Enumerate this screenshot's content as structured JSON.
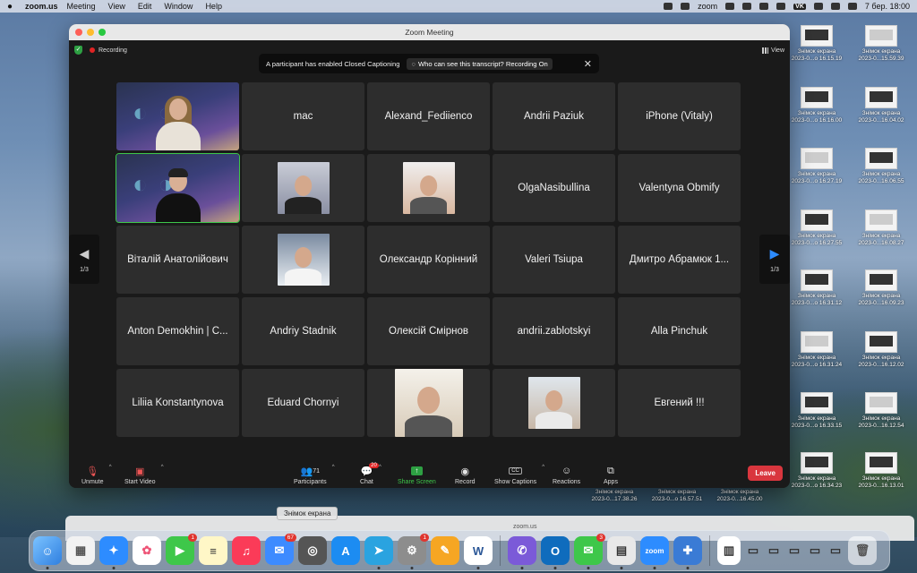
{
  "menubar": {
    "app_name": "zoom.us",
    "items": [
      "Meeting",
      "View",
      "Edit",
      "Window",
      "Help"
    ],
    "zoom_label": "zoom",
    "vk_label": "VK",
    "date_time": "7 бер.  18:00"
  },
  "window": {
    "title": "Zoom Meeting",
    "recording_label": "Recording",
    "view_label": "View"
  },
  "toast": {
    "message": "A participant has enabled Closed Captioning",
    "link": "Who can see this transcript? Recording On",
    "close": "✕"
  },
  "participants": [
    {
      "name": "",
      "type": "camera",
      "gender": "f"
    },
    {
      "name": "mac",
      "type": "name"
    },
    {
      "name": "Alexand_Fediienco",
      "type": "name"
    },
    {
      "name": "Andrii Paziuk",
      "type": "name"
    },
    {
      "name": "iPhone (Vitaly)",
      "type": "name"
    },
    {
      "name": "",
      "type": "camera",
      "gender": "m",
      "active": true
    },
    {
      "name": "",
      "type": "photo"
    },
    {
      "name": "",
      "type": "photo"
    },
    {
      "name": "OlgaNasibullina",
      "type": "name"
    },
    {
      "name": "Valentyna Obmify",
      "type": "name"
    },
    {
      "name": "Віталій Анатолійович",
      "type": "name"
    },
    {
      "name": "",
      "type": "photo"
    },
    {
      "name": "Олександр Корінний",
      "type": "name"
    },
    {
      "name": "Valeri Tsiupa",
      "type": "name"
    },
    {
      "name": "Дмитро Абрамюк 1...",
      "type": "name"
    },
    {
      "name": "Anton Demokhin | C...",
      "type": "name"
    },
    {
      "name": "Andriy Stadnik",
      "type": "name"
    },
    {
      "name": "Олексій Смірнов",
      "type": "name"
    },
    {
      "name": "andrii.zablotskyi",
      "type": "name"
    },
    {
      "name": "Alla Pinchuk",
      "type": "name"
    },
    {
      "name": "Liliia Konstantynova",
      "type": "name"
    },
    {
      "name": "Eduard Chornyi",
      "type": "name"
    },
    {
      "name": "",
      "type": "photo"
    },
    {
      "name": "",
      "type": "photo"
    },
    {
      "name": "Евгений !!!",
      "type": "name"
    }
  ],
  "pager": {
    "left": "1/3",
    "right": "1/3"
  },
  "toolbar": {
    "unmute": "Unmute",
    "start_video": "Start Video",
    "participants": "Participants",
    "participants_count": "71",
    "chat": "Chat",
    "chat_badge": "20",
    "share_screen": "Share Screen",
    "record": "Record",
    "show_captions": "Show Captions",
    "cc": "CC",
    "reactions": "Reactions",
    "apps": "Apps",
    "leave": "Leave"
  },
  "desktop_files": [
    {
      "label": "Знімок екрана\n2023-0...o 16.15.19"
    },
    {
      "label": "Знімок екрана\n2023-0...15.59.39"
    },
    {
      "label": "Знімок екрана\n2023-0...o 16.16.00"
    },
    {
      "label": "Знімок екрана\n2023-0...16.04.02"
    },
    {
      "label": "Знімок екрана\n2023-0...o 16.27.19"
    },
    {
      "label": "Знімок екрана\n2023-0...16.06.55"
    },
    {
      "label": "Знімок екрана\n2023-0...o 16.27.55"
    },
    {
      "label": "Знімок екрана\n2023-0...16.08.27"
    },
    {
      "label": "Знімок екрана\n2023-0...o 16.31.12"
    },
    {
      "label": "Знімок екрана\n2023-0...16.09.23"
    },
    {
      "label": "Знімок екрана\n2023-0...o 16.31.24"
    },
    {
      "label": "Знімок екрана\n2023-0...16.12.02"
    },
    {
      "label": "Знімок екрана\n2023-0...o 16.33.15"
    },
    {
      "label": "Знімок екрана\n2023-0...16.12.54"
    },
    {
      "label": "Знімок екрана\n2023-0...o 16.34.23"
    },
    {
      "label": "Знімок екрана\n2023-0...16.13.01"
    },
    {
      "label": "Знімок екрана\n2023-0...17.38.26"
    },
    {
      "label": "Знімок екрана\n2023-0...o 16.57.51"
    },
    {
      "label": "Знімок екрана\n2023-0...16.45.00"
    }
  ],
  "tooltip": "Знімок екрана",
  "safari_url": "zoom.us",
  "dock": {
    "badges": {
      "facetime": "1",
      "mail": "67",
      "settings": "1",
      "messages": "3"
    },
    "labels": {
      "zoom": "zoom",
      "word": "W"
    }
  }
}
